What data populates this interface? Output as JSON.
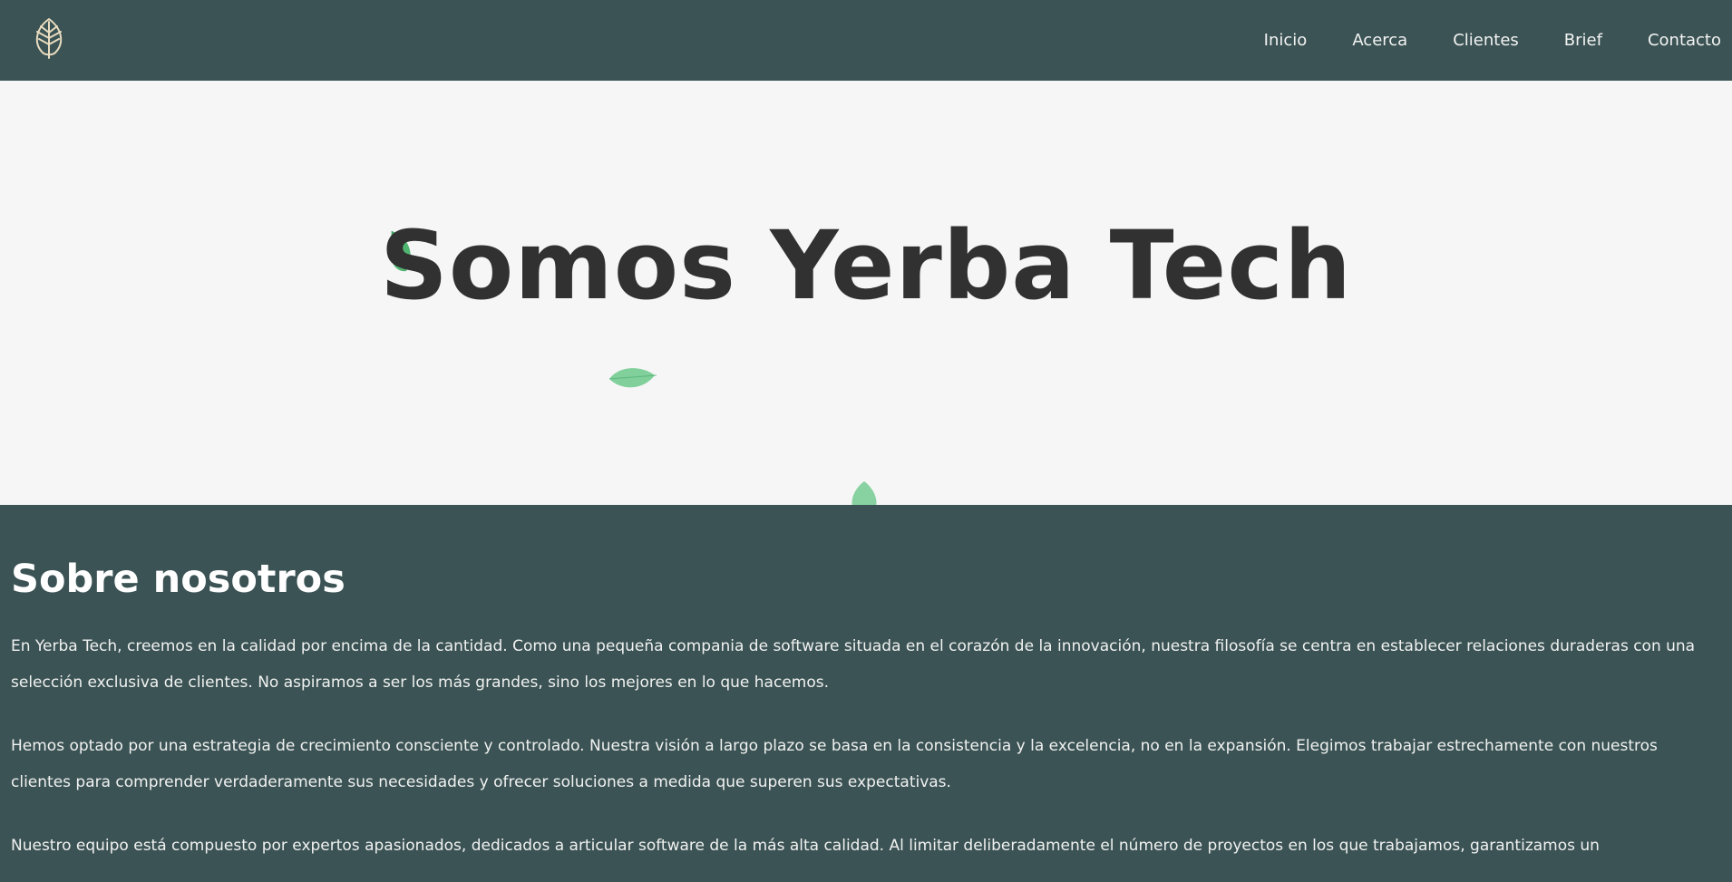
{
  "header": {
    "logo_icon": "leaf-logo-icon",
    "nav": [
      {
        "label": "Inicio"
      },
      {
        "label": "Acerca"
      },
      {
        "label": "Clientes"
      },
      {
        "label": "Brief"
      },
      {
        "label": "Contacto"
      }
    ]
  },
  "hero": {
    "title": "Somos Yerba Tech",
    "decoration_icon": "falling-leaf-icon"
  },
  "about": {
    "title": "Sobre nosotros",
    "paragraphs": [
      "En Yerba Tech, creemos en la calidad por encima de la cantidad. Como una pequeña compania de software situada en el corazón de la innovación, nuestra filosofía se centra en establecer relaciones duraderas con una selección exclusiva de clientes. No aspiramos a ser los más grandes, sino los mejores en lo que hacemos.",
      "Hemos optado por una estrategia de crecimiento consciente y controlado. Nuestra visión a largo plazo se basa en la consistencia y la excelencia, no en la expansión. Elegimos trabajar estrechamente con nuestros clientes para comprender verdaderamente sus necesidades y ofrecer soluciones a medida que superen sus expectativas.",
      "Nuestro equipo está compuesto por expertos apasionados, dedicados a articular software de la más alta calidad. Al limitar deliberadamente el número de proyectos en los que trabajamos, garantizamos un"
    ]
  },
  "colors": {
    "primary_dark": "#3b5354",
    "hero_background": "#f6f6f6",
    "title_text": "#313131",
    "leaf_green": "#5cbf7a",
    "logo_gold": "#e9dcc0"
  }
}
